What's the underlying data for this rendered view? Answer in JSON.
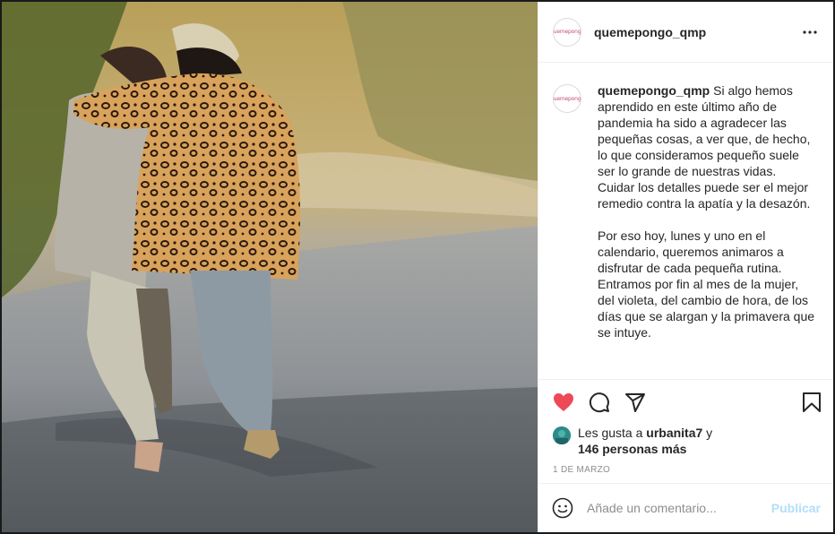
{
  "post": {
    "photo": {
      "alt": "Dos mujeres caminando abrazadas por un camino",
      "colors": {
        "sky": "#c9b67a",
        "road": "#7f8489",
        "foliage": "#7a8a3a"
      }
    },
    "header": {
      "avatar_text": "quemepongo",
      "username": "quemepongo_qmp",
      "more_icon": "more-horizontal-icon"
    },
    "caption": {
      "username": "quemepongo_qmp",
      "text": " Si algo hemos aprendido en este último año de pandemia ha sido a agradecer las pequeñas cosas, a ver que, de hecho, lo que consideramos pequeño suele ser lo grande de nuestras vidas.\nCuidar los detalles puede ser el mejor remedio contra la apatía y la desazón.\n\nPor eso hoy, lunes y uno en el calendario, queremos animaros a disfrutar de cada pequeña rutina. Entramos por fin al mes de la mujer, del violeta, del cambio de hora, de los días que se alargan y la primavera que se intuye."
    },
    "actions": {
      "like_icon": "heart-filled-icon",
      "comment_icon": "comment-icon",
      "share_icon": "send-icon",
      "save_icon": "bookmark-icon",
      "like_color": "#ed4956"
    },
    "likes": {
      "prefix": "Les gusta a ",
      "user": "urbanita7",
      "middle": " y",
      "others": "146 personas más"
    },
    "date": "1 DE MARZO",
    "comment_box": {
      "emoji_icon": "emoji-icon",
      "placeholder": "Añade un comentario...",
      "publish_label": "Publicar",
      "publish_color": "#b2dffc"
    }
  }
}
